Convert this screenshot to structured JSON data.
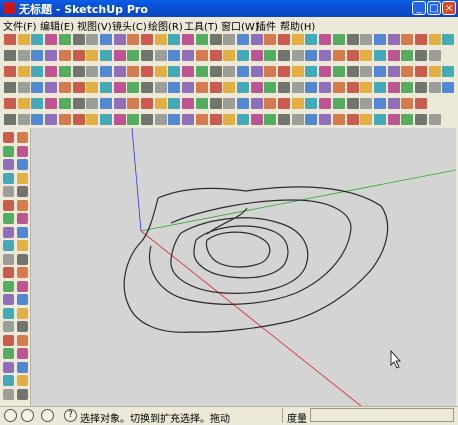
{
  "window": {
    "title": "无标题 - SketchUp Pro",
    "minimize": "_",
    "maximize": "□",
    "close": "×"
  },
  "menu": [
    "文件(F)",
    "编辑(E)",
    "视图(V)",
    "镜头(C)",
    "绘图(R)",
    "工具(T)",
    "窗口(W)",
    "插件",
    "帮助(H)"
  ],
  "status": {
    "message": "选择对象。切换到扩充选择。拖动",
    "measure_label": "度量",
    "measure_value": "",
    "help_icon": "?"
  },
  "colors": {
    "viewport_bg": "#d4d4d4",
    "axis_red": "#d82a2a",
    "axis_green": "#2aa82a",
    "axis_blue": "#2a3ad8",
    "contour": "#2b2b2b"
  }
}
